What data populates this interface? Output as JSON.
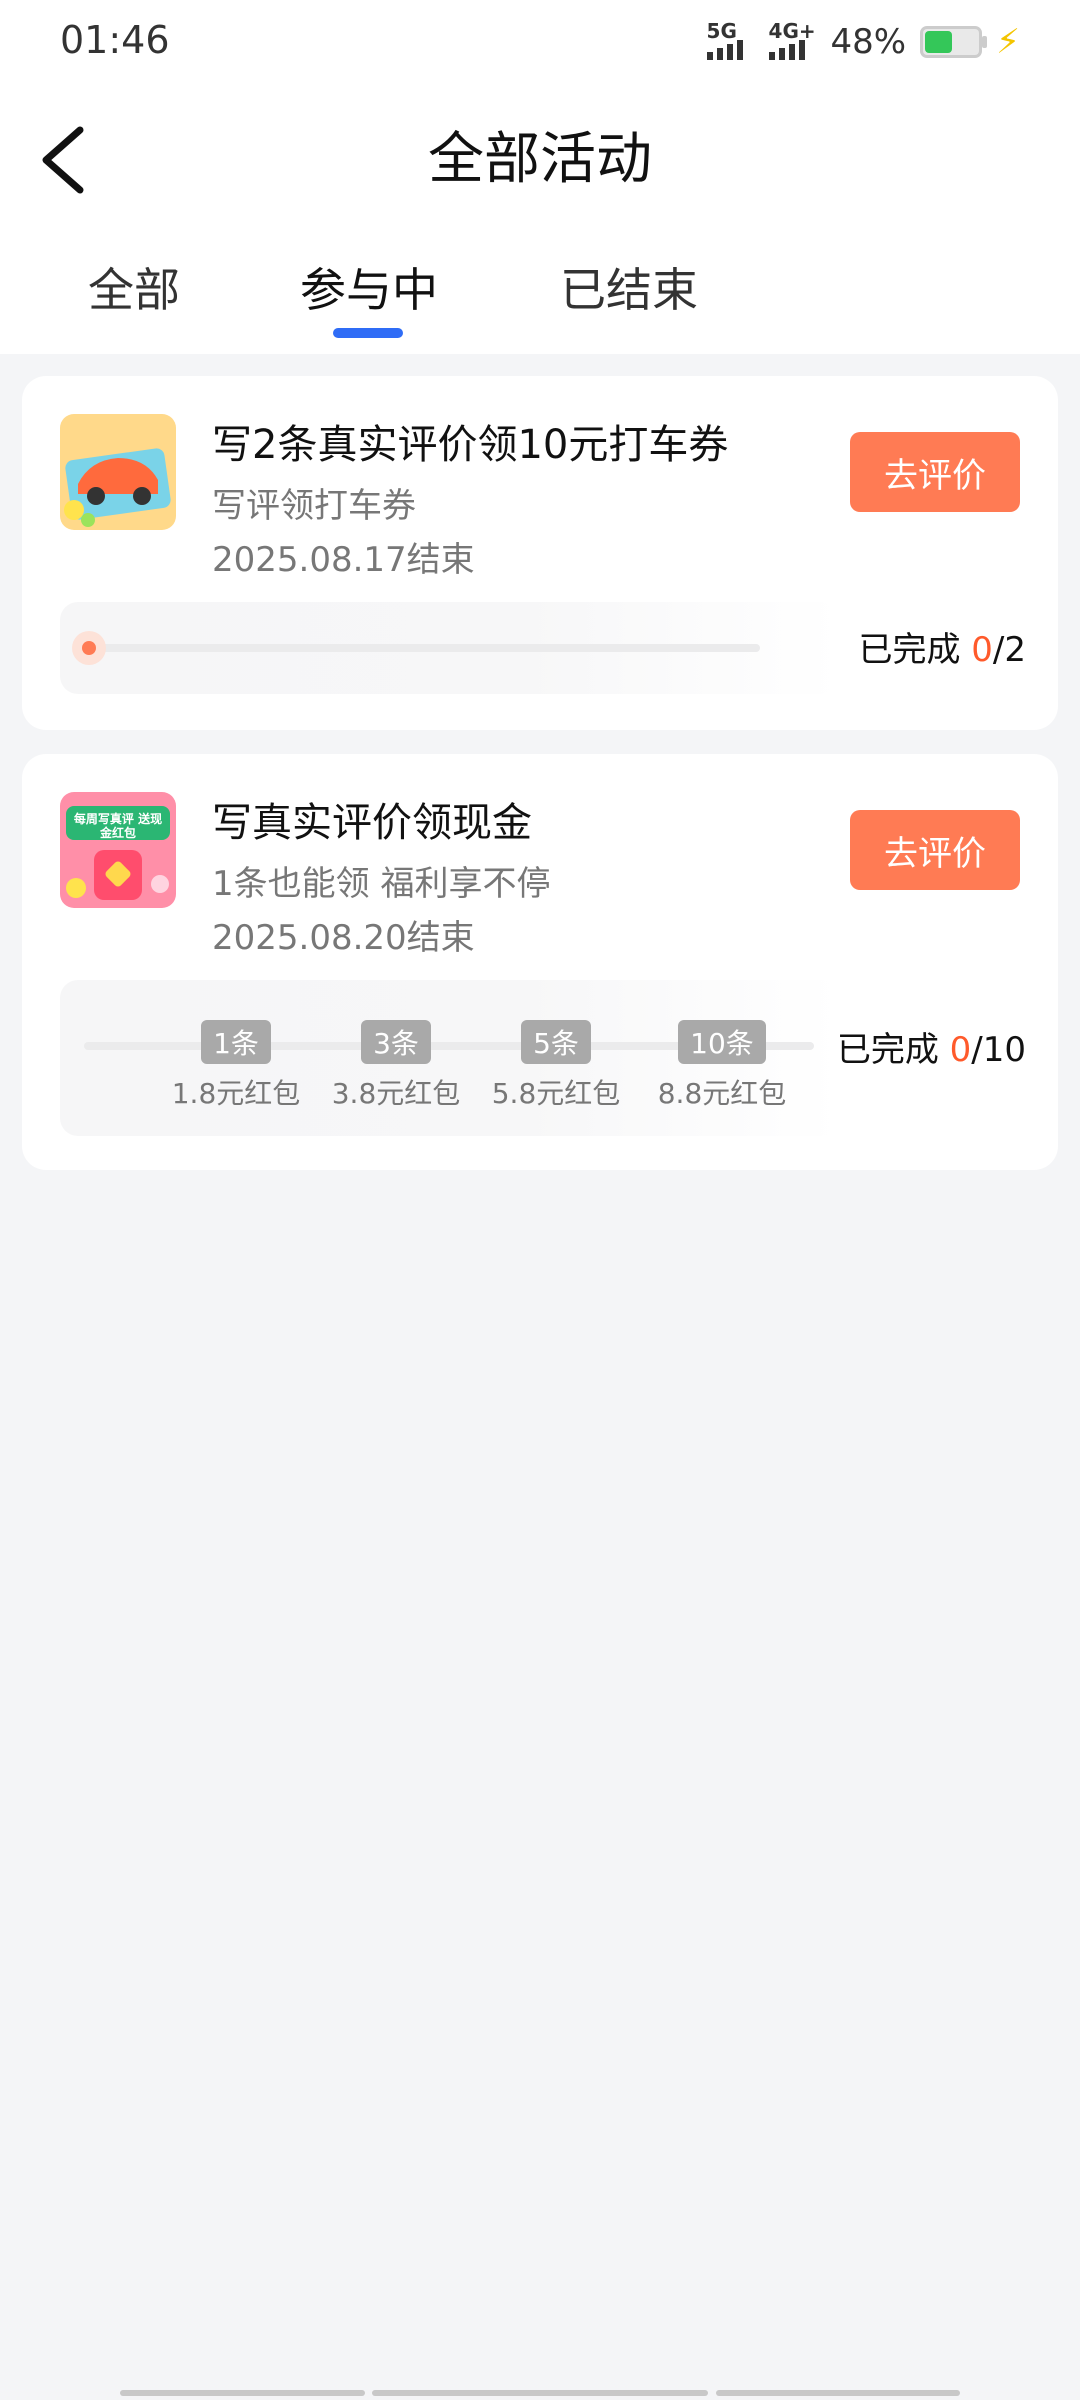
{
  "status_bar": {
    "time": "01:46",
    "network_1": "5G",
    "network_2": "4G+",
    "battery_percent": "48%"
  },
  "header": {
    "title": "全部活动",
    "tabs": [
      {
        "label": "全部"
      },
      {
        "label": "参与中"
      },
      {
        "label": "已结束"
      }
    ],
    "active_tab": "参与中"
  },
  "cards": [
    {
      "title": "写2条真实评价领10元打车券",
      "subtitle": "写评领打车券",
      "end_date": "2025.08.17结束",
      "button_label": "去评价",
      "done_label": "已完成",
      "done_current": "0",
      "done_total": "/2",
      "progress_fraction": 0
    },
    {
      "title": "写真实评价领现金",
      "subtitle": "1条也能领 福利享不停",
      "end_date": "2025.08.20结束",
      "button_label": "去评价",
      "done_label": "已完成",
      "done_current": "0",
      "done_total": "/10",
      "milestones": [
        {
          "count": "1条",
          "reward": "1.8元红包"
        },
        {
          "count": "3条",
          "reward": "3.8元红包"
        },
        {
          "count": "5条",
          "reward": "5.8元红包"
        },
        {
          "count": "10条",
          "reward": "8.8元红包"
        }
      ],
      "thumb_text": "每周写真评 送现金红包"
    }
  ],
  "colors": {
    "accent_button": "#ff7b54",
    "tab_indicator": "#2f6cf6",
    "progress_current": "#ff5a2b"
  }
}
